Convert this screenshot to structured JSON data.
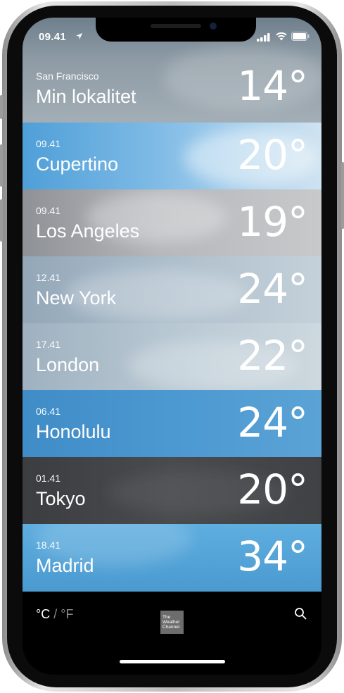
{
  "status_bar": {
    "time": "09.41"
  },
  "locations": [
    {
      "subtitle": "San Francisco",
      "city": "Min lokalitet",
      "temperature": "14°"
    },
    {
      "subtitle": "09.41",
      "city": "Cupertino",
      "temperature": "20°"
    },
    {
      "subtitle": "09.41",
      "city": "Los Angeles",
      "temperature": "19°"
    },
    {
      "subtitle": "12.41",
      "city": "New York",
      "temperature": "24°"
    },
    {
      "subtitle": "17.41",
      "city": "London",
      "temperature": "22°"
    },
    {
      "subtitle": "06.41",
      "city": "Honolulu",
      "temperature": "24°"
    },
    {
      "subtitle": "01.41",
      "city": "Tokyo",
      "temperature": "20°"
    },
    {
      "subtitle": "18.41",
      "city": "Madrid",
      "temperature": "34°"
    }
  ],
  "bottom_bar": {
    "unit_celsius": "°C",
    "unit_separator": "/",
    "unit_fahrenheit": "°F",
    "logo_text": "The Weather Channel",
    "logo_line1": "The",
    "logo_line2": "Weather",
    "logo_line3": "Channel"
  },
  "icons": [
    "location-arrow-icon",
    "signal-icon",
    "wifi-icon",
    "battery-icon",
    "weather-channel-logo",
    "search-icon"
  ]
}
